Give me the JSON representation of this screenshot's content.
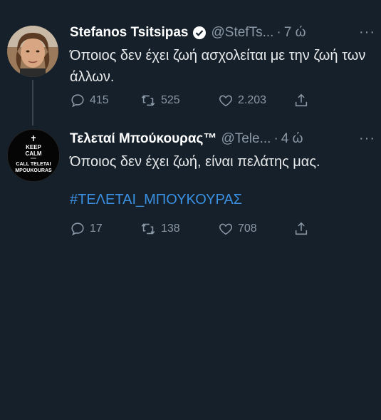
{
  "tweets": [
    {
      "name": "Stefanos Tsitsipas",
      "handle": "@StefTs...",
      "dot": "·",
      "time": "7 ώ",
      "more": "···",
      "text": "Όποιος δεν έχει ζωή ασχολείται με την ζωή των άλλων.",
      "replies": "415",
      "retweets": "525",
      "likes": "2.203"
    },
    {
      "name": "Τελεταί Μπούκουρας™",
      "handle": "@Tele...",
      "dot": "·",
      "time": "4 ώ",
      "more": "···",
      "text": "Όποιος δεν έχει ζωή, είναι πελάτης μας.",
      "hashtag": "#ΤΕΛΕΤΑΙ_ΜΠΟΥΚΟΥΡΑΣ",
      "replies": "17",
      "retweets": "138",
      "likes": "708",
      "avatar_lines": [
        "KEEP",
        "CALM",
        "CALL TELETAI",
        "MPOUKOURAS"
      ]
    }
  ],
  "colors": {
    "background": "#15202b",
    "hashtag": "#3a8fe0",
    "muted": "#8b98a5"
  }
}
